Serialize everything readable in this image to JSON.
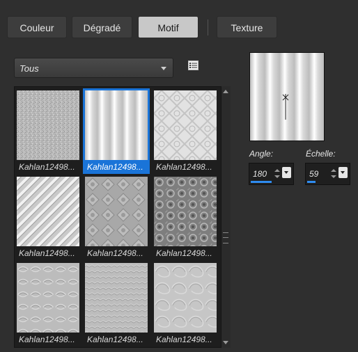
{
  "tabs": [
    {
      "label": "Couleur",
      "active": false
    },
    {
      "label": "Dégradé",
      "active": false
    },
    {
      "label": "Motif",
      "active": true
    },
    {
      "label": "Texture",
      "active": false
    }
  ],
  "filter": {
    "selected": "Tous"
  },
  "patterns": [
    {
      "label": "Kahlan12498...",
      "style": "noise",
      "selected": false
    },
    {
      "label": "Kahlan12498...",
      "style": "vstripes",
      "selected": true
    },
    {
      "label": "Kahlan12498...",
      "style": "geo",
      "selected": false
    },
    {
      "label": "Kahlan12498...",
      "style": "diagonal",
      "selected": false
    },
    {
      "label": "Kahlan12498...",
      "style": "tiles",
      "selected": false
    },
    {
      "label": "Kahlan12498...",
      "style": "floral",
      "selected": false
    },
    {
      "label": "Kahlan12498...",
      "style": "emboss",
      "selected": false
    },
    {
      "label": "Kahlan12498...",
      "style": "emboss2",
      "selected": false
    },
    {
      "label": "Kahlan12498...",
      "style": "swirl",
      "selected": false
    }
  ],
  "angle": {
    "label": "Angle:",
    "value": "180",
    "level": 0.5
  },
  "scale": {
    "label": "Échelle:",
    "value": "59",
    "level": 0.2
  },
  "colors": {
    "accent": "#1a74d8",
    "panel": "#2f2f2f"
  }
}
